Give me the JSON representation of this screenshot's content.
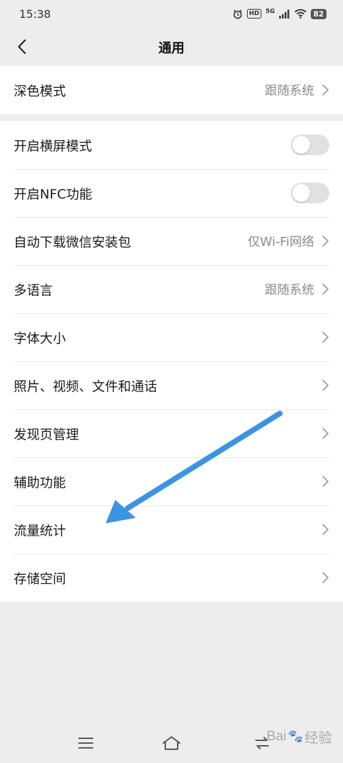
{
  "status_bar": {
    "time": "15:38",
    "hd": "HD",
    "network": "5G",
    "battery": "82"
  },
  "header": {
    "title": "通用"
  },
  "group1": {
    "rows": [
      {
        "label": "深色模式",
        "value": "跟随系统"
      }
    ]
  },
  "group2": {
    "rows": [
      {
        "label": "开启横屏模式"
      },
      {
        "label": "开启NFC功能"
      },
      {
        "label": "自动下载微信安装包",
        "value": "仅Wi-Fi网络"
      },
      {
        "label": "多语言",
        "value": "跟随系统"
      },
      {
        "label": "字体大小"
      },
      {
        "label": "照片、视频、文件和通话"
      },
      {
        "label": "发现页管理"
      },
      {
        "label": "辅助功能"
      },
      {
        "label": "流量统计"
      },
      {
        "label": "存储空间"
      }
    ]
  },
  "toggles": {
    "landscape_on": false,
    "nfc_on": false
  },
  "annotation": {
    "arrow_color": "#3b93e3"
  },
  "watermark": {
    "left": "Bai",
    "right": "经验"
  },
  "icons": [
    "alarm-icon",
    "signal-icon",
    "wifi-icon",
    "back-icon",
    "chevron-right-icon",
    "menu-icon",
    "home-icon",
    "recent-apps-icon"
  ]
}
